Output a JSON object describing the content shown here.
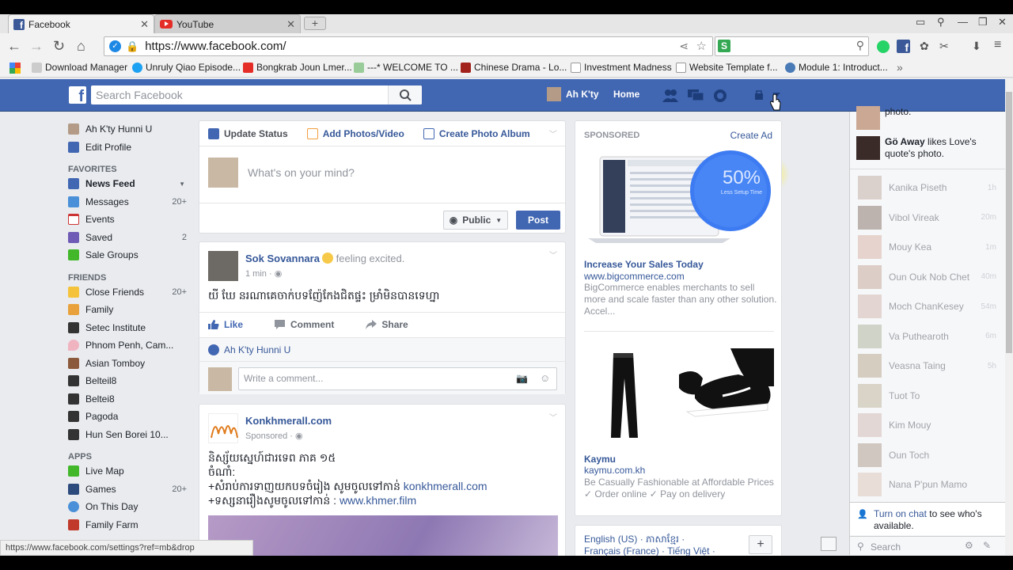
{
  "browser": {
    "tabs": [
      {
        "title": "Facebook",
        "icon": "facebook-favicon"
      },
      {
        "title": "YouTube",
        "icon": "youtube-favicon"
      }
    ],
    "url": "https://www.facebook.com/",
    "bookmarks": [
      "Download Manager",
      "Unruly Qiao Episode...",
      "Bongkrab Joun Lmer...",
      "---* WELCOME TO ...",
      "Chinese Drama - Lo...",
      "Investment Madness",
      "Website Template f...",
      "Module 1: Introduct..."
    ],
    "status_url": "https://www.facebook.com/settings?ref=mb&drop"
  },
  "fb_header": {
    "search_placeholder": "Search Facebook",
    "user_name": "Ah K'ty",
    "home_label": "Home"
  },
  "left_nav": {
    "profile_name": "Ah K'ty Hunni U",
    "edit_profile": "Edit Profile",
    "favorites_heading": "FAVORITES",
    "favorites": [
      {
        "label": "News Feed",
        "count": ""
      },
      {
        "label": "Messages",
        "count": "20+"
      },
      {
        "label": "Events",
        "count": ""
      },
      {
        "label": "Saved",
        "count": "2"
      },
      {
        "label": "Sale Groups",
        "count": ""
      }
    ],
    "friends_heading": "FRIENDS",
    "friends": [
      {
        "label": "Close Friends",
        "count": "20+"
      },
      {
        "label": "Family",
        "count": ""
      },
      {
        "label": "Setec Institute",
        "count": ""
      },
      {
        "label": "Phnom Penh, Cam...",
        "count": ""
      },
      {
        "label": "Asian Tomboy",
        "count": ""
      },
      {
        "label": "Belteil8",
        "count": ""
      },
      {
        "label": "Beltei8",
        "count": ""
      },
      {
        "label": "Pagoda",
        "count": ""
      },
      {
        "label": "Hun Sen Borei 10...",
        "count": ""
      }
    ],
    "apps_heading": "APPS",
    "apps": [
      {
        "label": "Live Map",
        "count": ""
      },
      {
        "label": "Games",
        "count": "20+"
      },
      {
        "label": "On This Day",
        "count": ""
      },
      {
        "label": "Family Farm",
        "count": ""
      }
    ]
  },
  "composer": {
    "tab_update": "Update Status",
    "tab_photos": "Add Photos/Video",
    "tab_album": "Create Photo Album",
    "placeholder": "What's on your mind?",
    "privacy": "Public",
    "post_button": "Post"
  },
  "post1": {
    "author": "Sok Sovannara",
    "feeling": "feeling excited.",
    "time": "1 min",
    "text": "យី ឃែ នរណាគេចាក់បទញ៉ែកែងជិតផ្ទះ ម្រាំមិនបានទេហ្នា",
    "like": "Like",
    "comment": "Comment",
    "share": "Share",
    "liked_by": "Ah K'ty Hunni U",
    "comment_placeholder": "Write a comment..."
  },
  "post2": {
    "author": "Konkhmerall.com",
    "time": "Sponsored",
    "line1": "និស្ស័យស្នេហ៍ជារទេព ភាគ ១៥",
    "line2": "ចំណាំ:",
    "line3_prefix": "+សំរាប់ការទាញយកបទចំរៀង សូមចូលទៅកាន់ ",
    "line3_link": "konkhmerall.com",
    "line4_prefix": "+ទស្សនារឿងសូមចូលទៅកាន់ : ",
    "line4_link": "www.khmer.film"
  },
  "ads": {
    "heading": "SPONSORED",
    "create_ad": "Create Ad",
    "ad1": {
      "badge_value": "50%",
      "badge_sub": "Less Setup Time",
      "title": "Increase Your Sales Today",
      "url": "www.bigcommerce.com",
      "desc": "BigCommerce enables merchants to sell more and scale faster than any other solution. Accel..."
    },
    "ad2": {
      "title": "Kaymu",
      "url": "kaymu.com.kh",
      "desc": "Be Casually Fashionable at Affordable Prices ✓ Order online ✓ Pay on delivery"
    },
    "languages_line1": "English (US) · ភាសាខ្មែរ ·",
    "languages_line2": "Français (France) · Tiếng Việt ·"
  },
  "chat": {
    "tickers": [
      {
        "bold": "",
        "text": "photo."
      },
      {
        "bold": "Gö Away",
        "text": " likes Love's quote's photo."
      }
    ],
    "friends": [
      {
        "name": "Kanika Piseth",
        "time": "1h"
      },
      {
        "name": "Vibol Vireak",
        "time": "20m"
      },
      {
        "name": "Mouy Kea",
        "time": "1m"
      },
      {
        "name": "Oun Ouk Nob Chet",
        "time": "40m"
      },
      {
        "name": "Moch ChanKesey",
        "time": "54m"
      },
      {
        "name": "Va Puthearoth",
        "time": "6m"
      },
      {
        "name": "Veasna Taing",
        "time": "5h"
      },
      {
        "name": "Tuot To",
        "time": ""
      },
      {
        "name": "Kim Mouy",
        "time": ""
      },
      {
        "name": "Oun Toch",
        "time": ""
      },
      {
        "name": "Nana P'pun Mamo",
        "time": ""
      }
    ],
    "turn_on_link": "Turn on chat",
    "turn_on_rest": " to see who's available.",
    "search_placeholder": "Search"
  }
}
